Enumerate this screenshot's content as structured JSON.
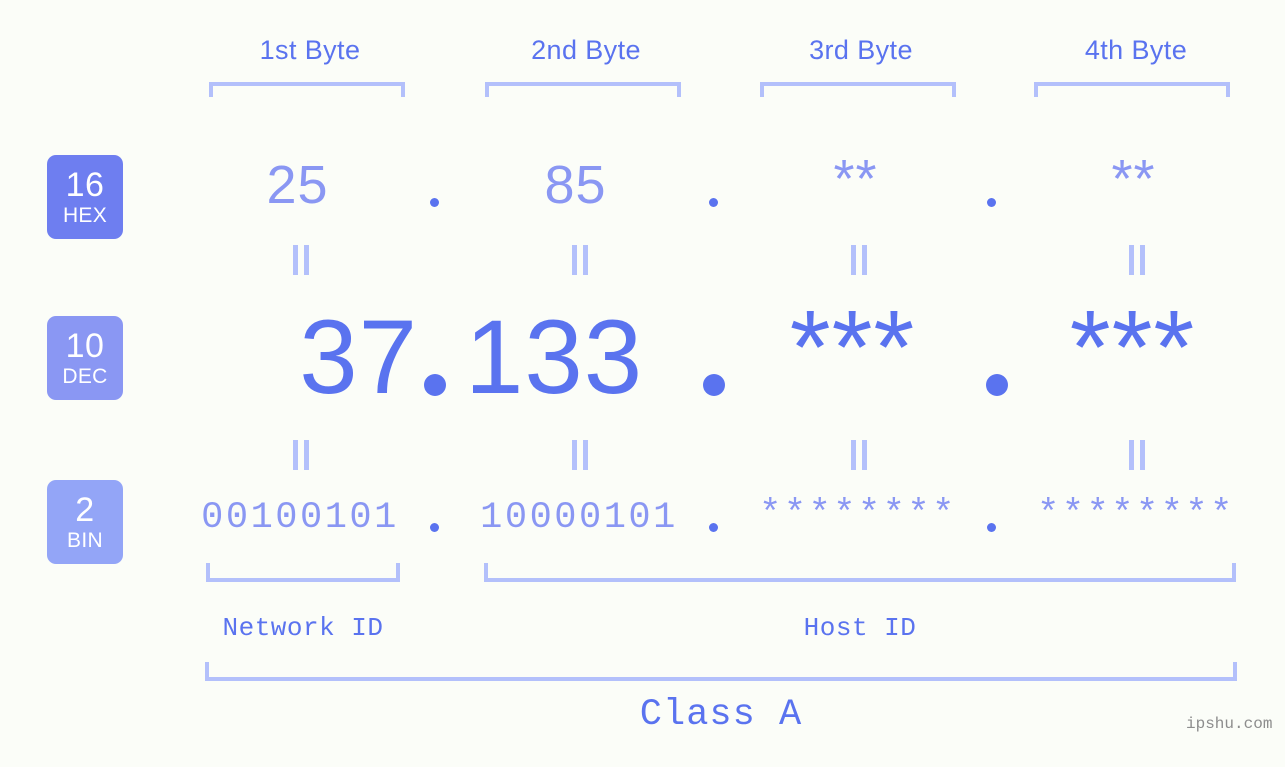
{
  "background_color": "#fbfdf8",
  "accent_color": "#5a73ef",
  "accent_light_color": "#8a97f3",
  "bracket_color": "#b3c0fb",
  "byte_headers": [
    {
      "label": "1st Byte"
    },
    {
      "label": "2nd Byte"
    },
    {
      "label": "3rd Byte"
    },
    {
      "label": "4th Byte"
    }
  ],
  "rows": {
    "hex": {
      "badge_number": "16",
      "badge_abbr": "HEX",
      "badge_color": "#6e7ef0",
      "values": [
        "25",
        "85",
        "**",
        "**"
      ],
      "separator": "."
    },
    "dec": {
      "badge_number": "10",
      "badge_abbr": "DEC",
      "badge_color": "#8a97f3",
      "values": [
        "37",
        "133",
        "***",
        "***"
      ],
      "separator": "."
    },
    "bin": {
      "badge_number": "2",
      "badge_abbr": "BIN",
      "badge_color": "#93a5f7",
      "values": [
        "00100101",
        "10000101",
        "********",
        "********"
      ],
      "separator": "."
    }
  },
  "equals_sign": "=",
  "id_sections": [
    {
      "label": "Network ID"
    },
    {
      "label": "Host ID"
    }
  ],
  "class_label": "Class A",
  "watermark": "ipshu.com"
}
